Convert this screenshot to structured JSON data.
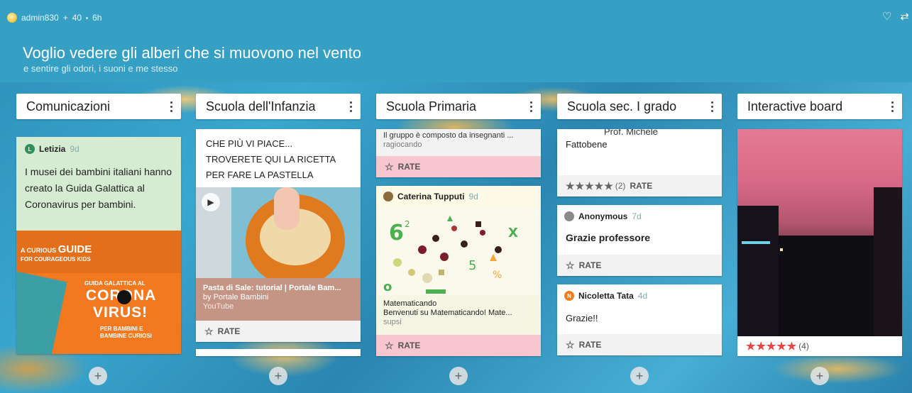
{
  "header": {
    "user": "admin830",
    "plus": "+",
    "points": "40",
    "age": "6h",
    "title": "Voglio vedere gli alberi che si muovono nel vento",
    "subtitle": "e sentire gli odori, i suoni e me stesso",
    "heart_icon": "♡",
    "remake_icon": "⇄"
  },
  "columns": [
    {
      "title": "Comunicazioni"
    },
    {
      "title": "Scuola dell'Infanzia"
    },
    {
      "title": "Scuola Primaria"
    },
    {
      "title": "Scuola sec. I grado"
    },
    {
      "title": "Interactive board"
    }
  ],
  "col1": {
    "card1": {
      "author": "Letizia",
      "author_initial": "L",
      "ago": "9d",
      "body": "I musei dei bambini italiani hanno creato la Guida Galattica al Coronavirus per bambini.",
      "poster": {
        "line1": "A CURIOUS",
        "line1b": "GUIDE",
        "line2": "FOR COURAGEOUS KIDS",
        "line3": "GUIDA GALATTICA AL",
        "line4": "CORONA",
        "line5": "VIRUS!",
        "line6": "PER BAMBINI E",
        "line7": "BAMBINE CURIOSI"
      }
    }
  },
  "col2": {
    "card1": {
      "body1": "CHE PIÙ VI PIACE...",
      "body2": "TROVERETE QUI  LA RICETTA",
      "body3": "PER FARE LA PASTELLA",
      "link_title": "Pasta di Sale: tutorial | Portale Bam...",
      "link_by": "by Portale Bambini",
      "link_source": "YouTube",
      "rate": "RATE"
    }
  },
  "col3": {
    "card1": {
      "text": "Il gruppo è composto da insegnanti ...",
      "sub": "ragiocando",
      "rate": "RATE"
    },
    "card2": {
      "author": "Caterina Tupputi",
      "ago": "9d",
      "link_title": "Matematicando",
      "link_desc": "Benvenuti su Matematicando! Mate...",
      "link_source": "supsi",
      "rate": "RATE"
    }
  },
  "col4": {
    "card1": {
      "top": "Prof. Michele",
      "name": "Fattobene",
      "rating": "★★★★★",
      "rating_count": "(2)",
      "rate": "RATE"
    },
    "card2": {
      "author": "Anonymous",
      "ago": "7d",
      "body": "Grazie professore",
      "rate": "RATE"
    },
    "card3": {
      "author": "Nicoletta Tata",
      "author_initial": "N",
      "ago": "4d",
      "body": "Grazie!!",
      "rate": "RATE"
    }
  },
  "col5": {
    "card1": {
      "rating": "★★★★★",
      "rating_count": "(4)"
    }
  },
  "add_label": "+",
  "colors": {
    "header_bg": "#36a0c4",
    "green_card": "#d6ecd2",
    "pink_rate": "#f8c6cf",
    "brown_link": "#c49485",
    "cream_link": "#f6f6e4",
    "poster_orange": "#f2791f",
    "poster_teal": "#3c9fa6",
    "rating_red": "#e84545"
  }
}
